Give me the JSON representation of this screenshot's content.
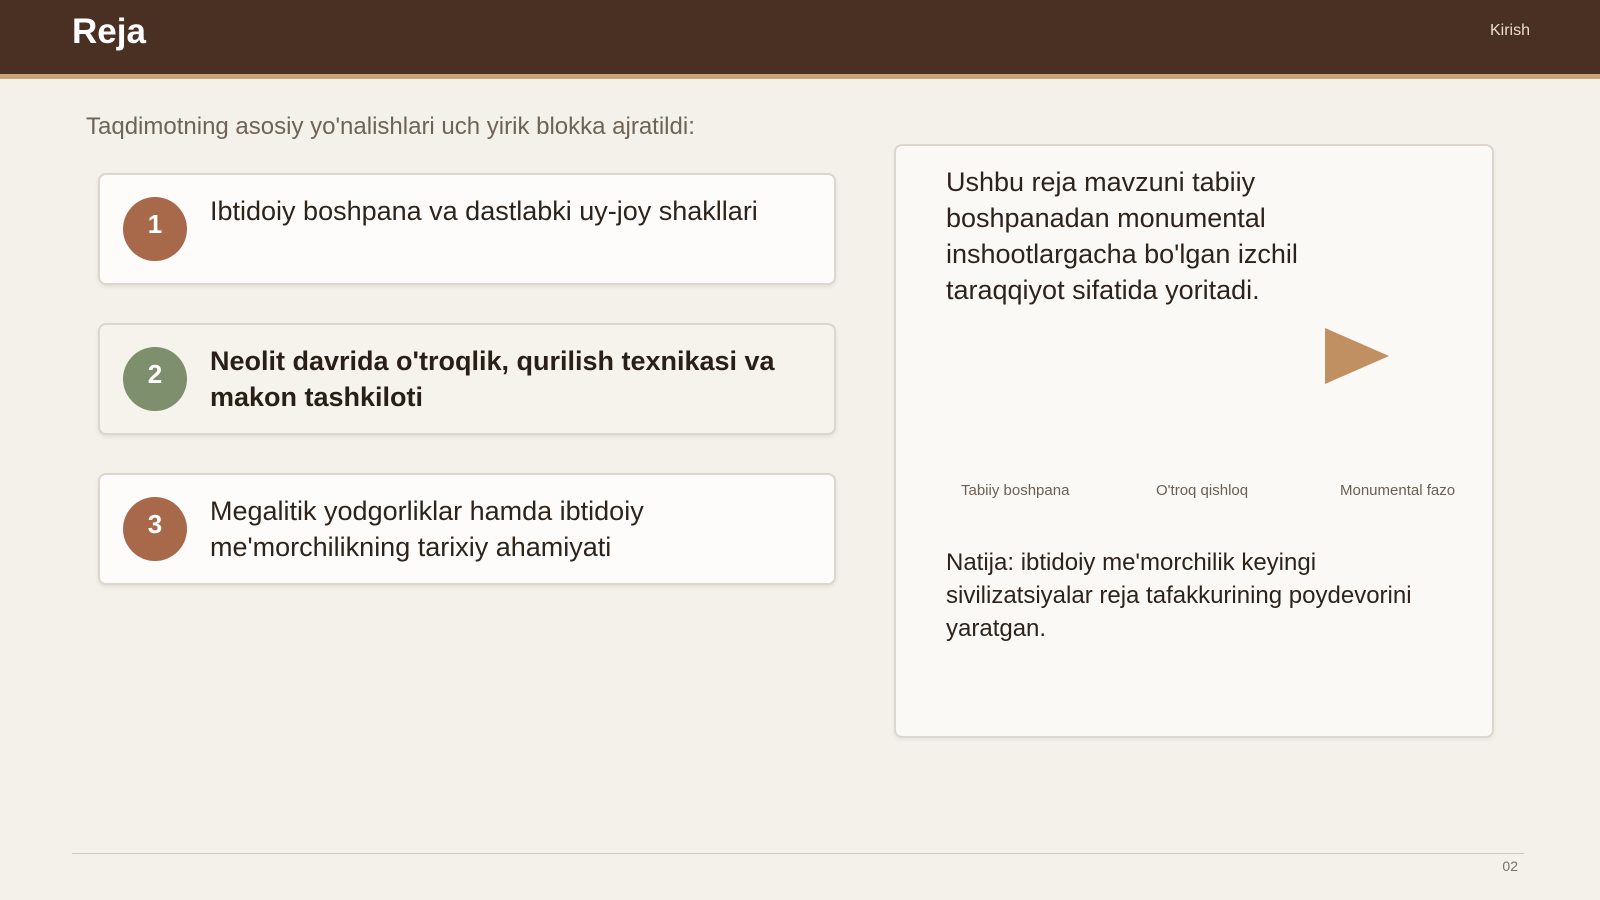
{
  "header": {
    "title": "Reja",
    "section": "Kirish",
    "background_color": "#4a3023",
    "accent_color": "#c9a575"
  },
  "intro": "Taqdimotning asosiy yo'nalishlari uch yirik blokka ajratildi:",
  "blocks": [
    {
      "number": "1",
      "text": "Ibtidoiy boshpana va dastlabki uy-joy shakllari",
      "badge_color": "#a8694a",
      "emphasized": false
    },
    {
      "number": "2",
      "text": "Neolit davrida o'troqlik, qurilish texnikasi va makon tashkiloti",
      "badge_color": "#7d8f6c",
      "emphasized": true
    },
    {
      "number": "3",
      "text": "Megalitik yodgorliklar hamda ibtidoiy me'morchilikning tarixiy ahamiyati",
      "badge_color": "#a8694a",
      "emphasized": false
    }
  ],
  "panel": {
    "description": "Ushbu reja mavzuni tabiiy boshpanadan monumental inshootlargacha bo'lgan izchil taraqqiyot sifatida yoritadi.",
    "stages": [
      "Tabiiy boshpana",
      "O'troq qishloq",
      "Monumental fazo"
    ],
    "result": "Natija: ibtidoiy me'morchilik keyingi sivilizatsiyalar reja tafakkurining poydevorini yaratgan.",
    "arrow_icon": "arrow-right-icon"
  },
  "footer": {
    "page_number": "02"
  }
}
